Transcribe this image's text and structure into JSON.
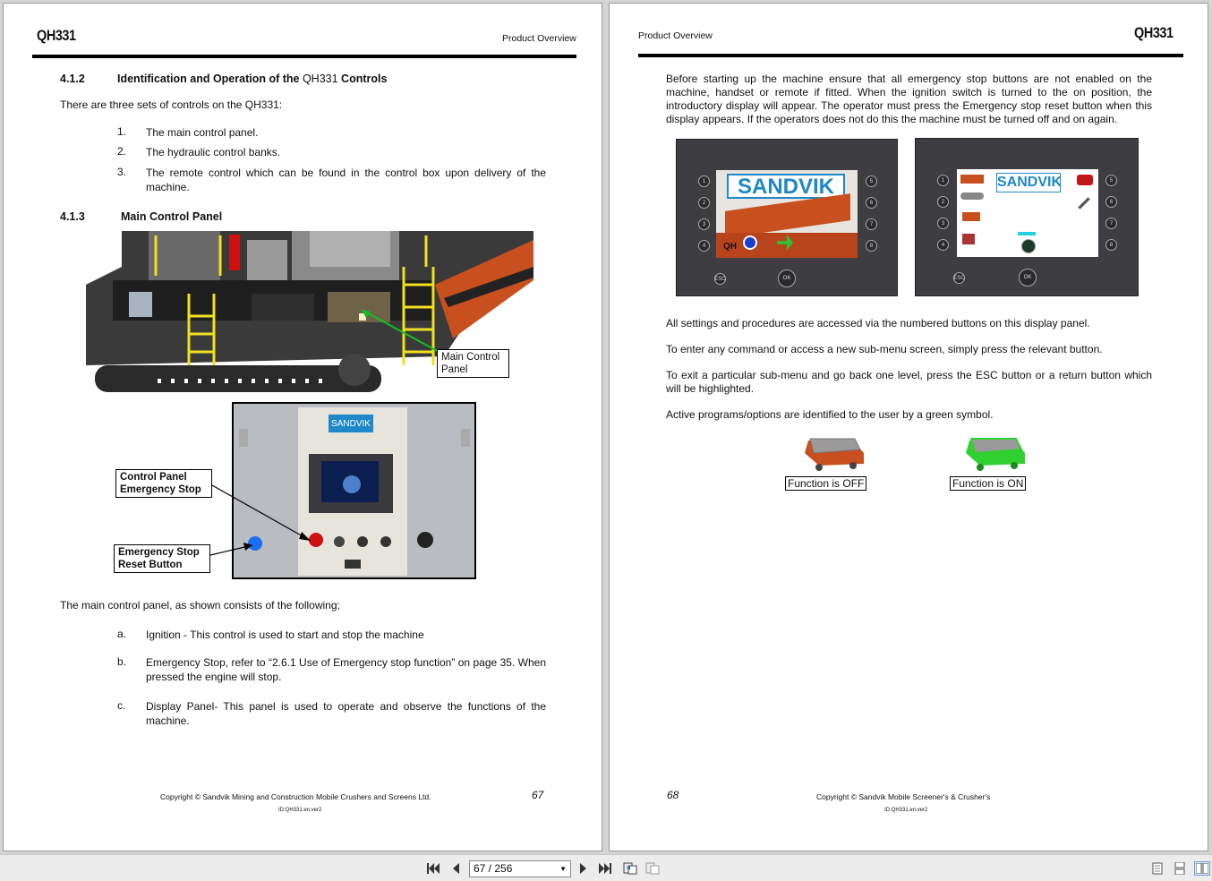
{
  "viewer": {
    "page_indicator": "67 / 256"
  },
  "left_page": {
    "logo": "QH331",
    "section": "Product Overview",
    "h412": {
      "num": "4.1.2",
      "title_a": "Identification and Operation of the ",
      "title_b": "QH331",
      "title_c": " Controls"
    },
    "intro": "There are three sets of controls on the QH331:",
    "controls_list": [
      {
        "num": "1.",
        "text": "The main control panel."
      },
      {
        "num": "2.",
        "text": "The hydraulic control banks."
      },
      {
        "num": "3.",
        "text": "The remote control which can be found in the control box upon delivery of the machine."
      }
    ],
    "h413": {
      "num": "4.1.3",
      "title": "Main Control Panel"
    },
    "callouts": {
      "main_control_panel": "Main Control Panel",
      "control_panel_estop": "Control Panel Emergency Stop",
      "estop_reset": "Emergency Stop Reset Button"
    },
    "panel_brand": "SANDVIK",
    "consists": "The main control panel, as shown consists of the following;",
    "parts_list": [
      {
        "num": "a.",
        "text": "Ignition - This control is used to start and stop the machine"
      },
      {
        "num": "b.",
        "text": "Emergency Stop, refer to “2.6.1 Use of Emergency stop function” on page 35. When pressed the engine will stop."
      },
      {
        "num": "c.",
        "text": "Display Panel- This panel is used to operate and observe the functions of the machine."
      }
    ],
    "copyright": "Copyright © Sandvik Mining and Construction Mobile Crushers and Screens Ltd.",
    "doc_id": "ID:QH331.en.ver2",
    "page_number": "67"
  },
  "right_page": {
    "logo": "QH331",
    "section": "Product Overview",
    "para1": "Before starting up the machine ensure that all emergency stop buttons are not enabled on the machine, handset or remote if fitted. When the ignition switch is turned to the on position, the introductory display will appear. The operator must press the Emergency stop reset button when this display appears. If the operators does not do this the machine must be turned off and on again.",
    "display_brand": "SANDVIK",
    "display_qh": "QH",
    "display_ok": "OK",
    "display_esc": "ESC",
    "para2": "All settings and procedures are accessed via the numbered buttons on this display panel.",
    "para3": "To enter any command or access a new sub-menu screen, simply press the relevant button.",
    "para4": "To exit a particular sub-menu and go back one level, press the ESC button or a return button which will be highlighted.",
    "para5": "Active programs/options are identified to the user by a green symbol.",
    "function_off": "Function is OFF",
    "function_on": "Function is ON",
    "copyright": "Copyright © Sandvik Mobile Screener's & Crusher's",
    "doc_id": "ID:QH331.en.ver2",
    "page_number": "68"
  },
  "colors": {
    "sandvik_blue": "#1e88c8",
    "machine_orange": "#c8501e",
    "ladder_yellow": "#f0e020",
    "callout_green": "#10c020",
    "estop_red": "#d01010",
    "reset_blue": "#1a6ef0"
  }
}
